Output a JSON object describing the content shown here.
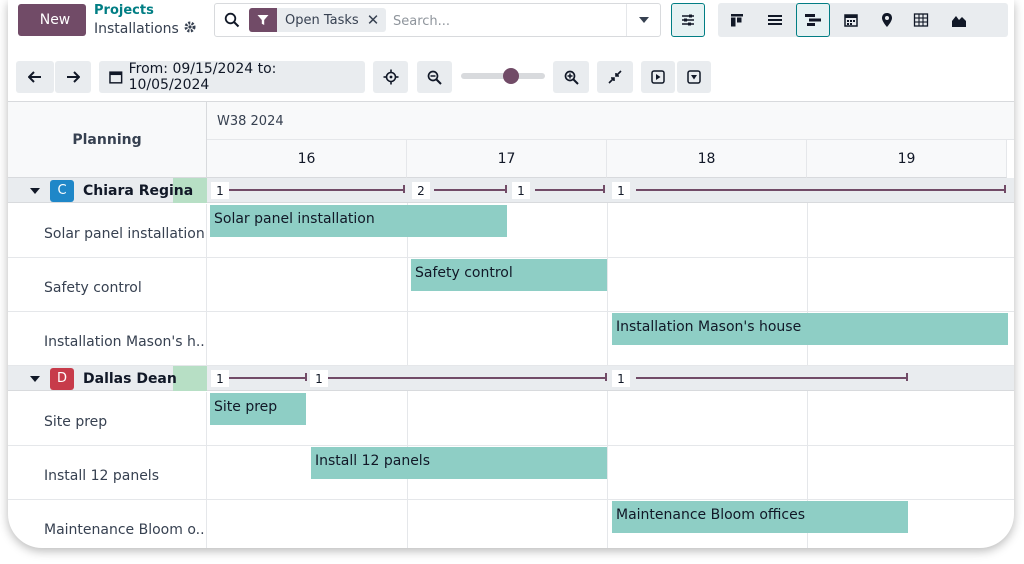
{
  "topbar": {
    "new_label": "New",
    "breadcrumb_app": "Projects",
    "breadcrumb_page": "Installations",
    "search": {
      "facet_label": "Open Tasks",
      "placeholder": "Search..."
    },
    "views": [
      "filter-settings-icon",
      "kanban-icon",
      "list-icon",
      "gantt-icon",
      "calendar-icon",
      "map-pin-icon",
      "pivot-icon",
      "graph-icon"
    ],
    "active_view": "gantt-icon"
  },
  "controls": {
    "date_range": "From: 09/15/2024 to: 10/05/2024",
    "zoom_fraction": 0.62
  },
  "gantt": {
    "planning_label": "Planning",
    "week_label": "W38 2024",
    "days": [
      "16",
      "17",
      "18",
      "19"
    ],
    "groups": [
      {
        "initial": "C",
        "name": "Chiara Regina",
        "avatar_color": "#1f87c8",
        "counts": [
          "1",
          "2",
          "1",
          "1"
        ],
        "tasks": [
          {
            "name": "Solar panel installation",
            "bar_label": "Solar panel installation"
          },
          {
            "name": "Safety control",
            "bar_label": "Safety control"
          },
          {
            "name": "Installation Mason's h...",
            "bar_label": "Installation Mason's house"
          }
        ]
      },
      {
        "initial": "D",
        "name": "Dallas Dean",
        "avatar_color": "#c73b4a",
        "counts": [
          "1",
          "1",
          "1"
        ],
        "tasks": [
          {
            "name": "Site prep",
            "bar_label": "Site prep"
          },
          {
            "name": "Install 12 panels",
            "bar_label": "Install 12 panels"
          },
          {
            "name": "Maintenance Bloom o...",
            "bar_label": "Maintenance Bloom offices"
          }
        ]
      }
    ]
  },
  "colors": {
    "brand": "#714B67",
    "accent": "#017e84",
    "bar": "#8ecec5"
  }
}
